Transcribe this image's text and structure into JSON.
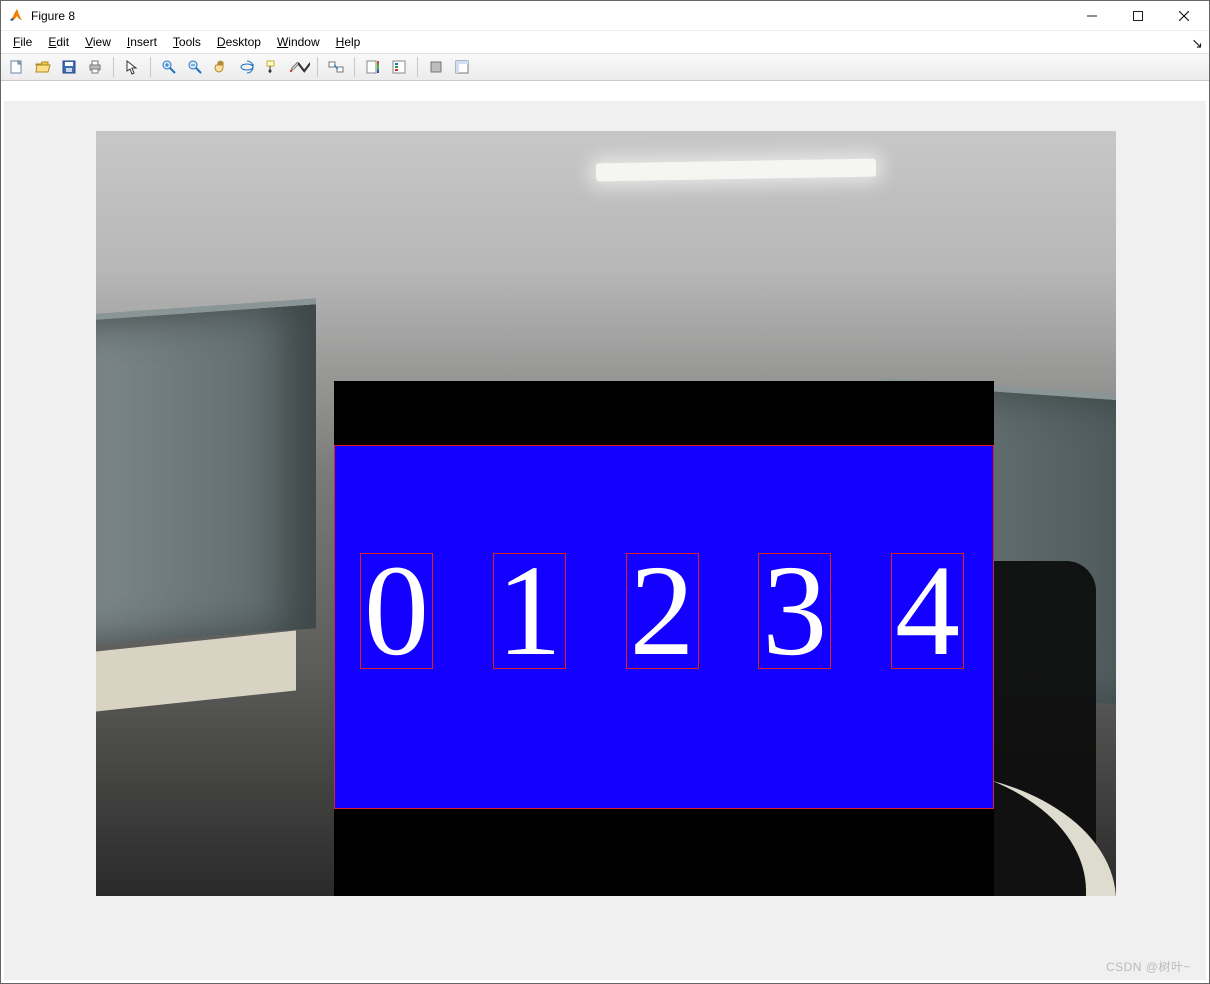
{
  "title": "Figure 8",
  "menus": {
    "file": {
      "label": "File",
      "ul": "F"
    },
    "edit": {
      "label": "Edit",
      "ul": "E"
    },
    "view": {
      "label": "View",
      "ul": "V"
    },
    "insert": {
      "label": "Insert",
      "ul": "I"
    },
    "tools": {
      "label": "Tools",
      "ul": "T"
    },
    "desktop": {
      "label": "Desktop",
      "ul": "D"
    },
    "window": {
      "label": "Window",
      "ul": "W"
    },
    "help": {
      "label": "Help",
      "ul": "H"
    }
  },
  "toolbar_icons": [
    "new-figure-icon",
    "open-icon",
    "save-icon",
    "print-icon",
    "pointer-icon",
    "zoom-in-icon",
    "zoom-out-icon",
    "pan-icon",
    "rotate3d-icon",
    "data-cursor-icon",
    "brush-icon",
    "link-plot-icon",
    "insert-colorbar-icon",
    "insert-legend-icon",
    "hide-tools-icon",
    "dock-icon"
  ],
  "digits": [
    "0",
    "1",
    "2",
    "3",
    "4"
  ],
  "watermark": "CSDN @树叶~"
}
